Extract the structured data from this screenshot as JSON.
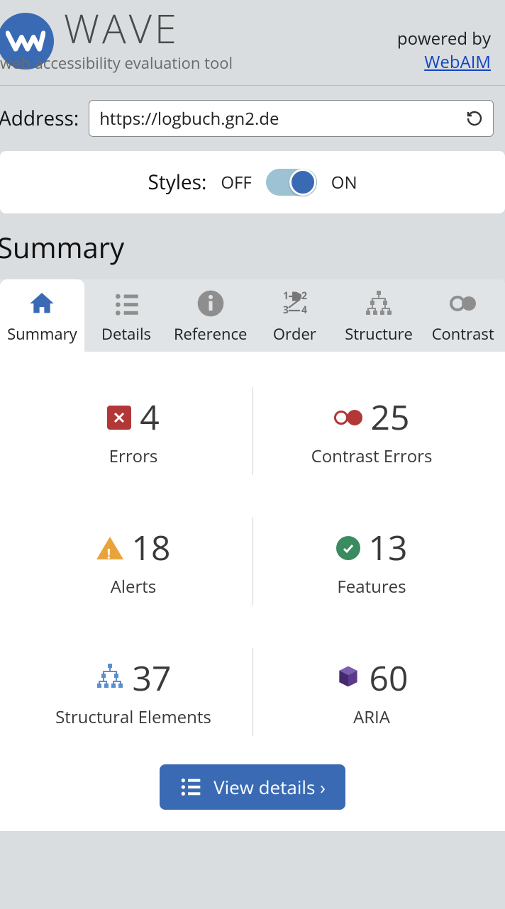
{
  "header": {
    "title": "WAVE",
    "subtitle": "web accessibility evaluation tool",
    "powered_by": "powered by",
    "powered_link": "WebAIM"
  },
  "address": {
    "label": "Address:",
    "value": "https://logbuch.gn2.de"
  },
  "styles": {
    "label": "Styles:",
    "off": "OFF",
    "on": "ON",
    "state": "on"
  },
  "section_title": "Summary",
  "tabs": [
    {
      "id": "summary",
      "label": "Summary",
      "active": true
    },
    {
      "id": "details",
      "label": "Details"
    },
    {
      "id": "reference",
      "label": "Reference"
    },
    {
      "id": "order",
      "label": "Order"
    },
    {
      "id": "structure",
      "label": "Structure"
    },
    {
      "id": "contrast",
      "label": "Contrast"
    }
  ],
  "summary": {
    "errors": {
      "count": 4,
      "label": "Errors"
    },
    "contrast": {
      "count": 25,
      "label": "Contrast Errors"
    },
    "alerts": {
      "count": 18,
      "label": "Alerts"
    },
    "features": {
      "count": 13,
      "label": "Features"
    },
    "structural": {
      "count": 37,
      "label": "Structural Elements"
    },
    "aria": {
      "count": 60,
      "label": "ARIA"
    }
  },
  "view_details_label": "View details ›"
}
